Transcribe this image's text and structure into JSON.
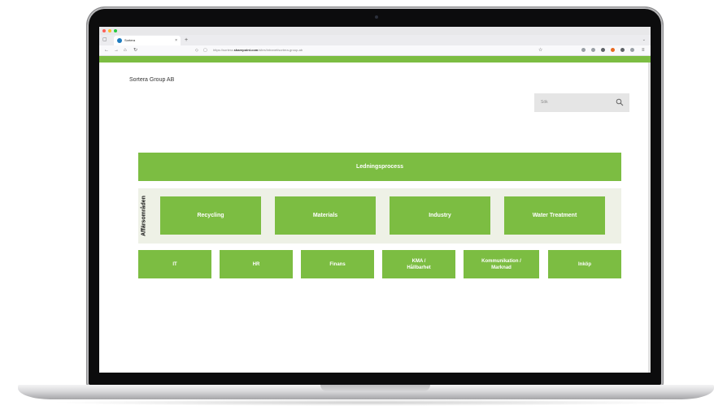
{
  "browser": {
    "tab_title": "Sortera",
    "tab_close": "×",
    "new_tab": "+",
    "url_prefix": "https://sortera.",
    "url_domain": "sharepoint.com",
    "url_path": "/sites/intranet/sortera-group-ab",
    "icons": [
      "back-icon",
      "forward-icon",
      "home-icon",
      "reload-icon",
      "shield-icon",
      "lock-icon",
      "star-icon"
    ]
  },
  "site": {
    "title": "Sortera Group AB",
    "search_placeholder": "Sök"
  },
  "process_map": {
    "management": "Ledningsprocess",
    "business_label": "Affärsområden",
    "business_areas": [
      "Recycling",
      "Materials",
      "Industry",
      "Water Treatment"
    ],
    "support": [
      "IT",
      "HR",
      "Finans",
      "KMA /\nHållbarhet",
      "Kommunikation /\nMarknad",
      "Inköp"
    ]
  },
  "colors": {
    "brand_green": "#7cbd42",
    "panel_bg": "#eef1e6",
    "search_bg": "#e5e5e5"
  }
}
